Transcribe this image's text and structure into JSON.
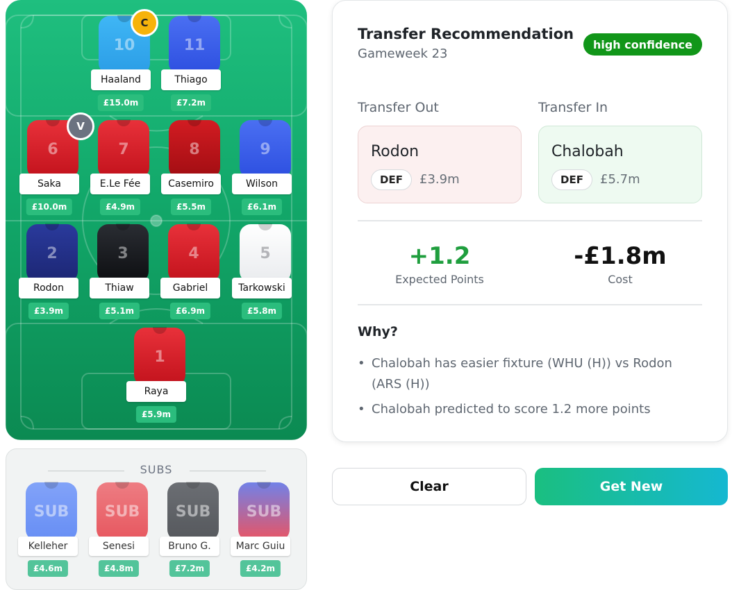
{
  "pitch": {
    "players": [
      {
        "name": "Haaland",
        "number": "10",
        "price": "£15.0m",
        "kit": "sky",
        "badge": "C"
      },
      {
        "name": "Thiago",
        "number": "11",
        "price": "£7.2m",
        "kit": "blue",
        "badge": ""
      },
      {
        "name": "Saka",
        "number": "6",
        "price": "£10.0m",
        "kit": "red",
        "badge": "V"
      },
      {
        "name": "E.Le Fée",
        "number": "7",
        "price": "£4.9m",
        "kit": "red",
        "badge": ""
      },
      {
        "name": "Casemiro",
        "number": "8",
        "price": "£5.5m",
        "kit": "dred",
        "badge": ""
      },
      {
        "name": "Wilson",
        "number": "9",
        "price": "£6.1m",
        "kit": "blue",
        "badge": ""
      },
      {
        "name": "Rodon",
        "number": "2",
        "price": "£3.9m",
        "kit": "navy",
        "badge": ""
      },
      {
        "name": "Thiaw",
        "number": "3",
        "price": "£5.1m",
        "kit": "black",
        "badge": ""
      },
      {
        "name": "Gabriel",
        "number": "4",
        "price": "£6.9m",
        "kit": "red",
        "badge": ""
      },
      {
        "name": "Tarkowski",
        "number": "5",
        "price": "£5.8m",
        "kit": "white",
        "badge": ""
      },
      {
        "name": "Raya",
        "number": "1",
        "price": "£5.9m",
        "kit": "red",
        "badge": ""
      }
    ]
  },
  "subs": {
    "title": "SUBS",
    "players": [
      {
        "name": "Kelleher",
        "label": "SUB",
        "price": "£4.6m",
        "kit": "#4f7df5"
      },
      {
        "name": "Senesi",
        "label": "SUB",
        "price": "£4.8m",
        "kit": "#e53c45"
      },
      {
        "name": "Bruno G.",
        "label": "SUB",
        "price": "£7.2m",
        "kit": "#3a3d42"
      },
      {
        "name": "Marc Guiu",
        "label": "SUB",
        "price": "£4.2m",
        "kit": "#5c6ee6"
      }
    ]
  },
  "recommendation": {
    "title": "Transfer Recommendation",
    "gameweek": "Gameweek 23",
    "confidence": "high confidence",
    "out_label": "Transfer Out",
    "in_label": "Transfer In",
    "out": {
      "name": "Rodon",
      "position": "DEF",
      "price": "£3.9m"
    },
    "in": {
      "name": "Chalobah",
      "position": "DEF",
      "price": "£5.7m"
    },
    "expected_points": "+1.2",
    "expected_points_label": "Expected Points",
    "cost": "-£1.8m",
    "cost_label": "Cost",
    "why_label": "Why?",
    "reasons": [
      "Chalobah has easier fixture (WHU (H)) vs Rodon (ARS (H))",
      "Chalobah predicted to score 1.2 more points"
    ]
  },
  "actions": {
    "clear_label": "Clear",
    "get_new_label": "Get New"
  },
  "colors": {
    "pitch": "#12a86a",
    "confidence_badge": "#119619",
    "points_positive": "#1f9e3e"
  }
}
